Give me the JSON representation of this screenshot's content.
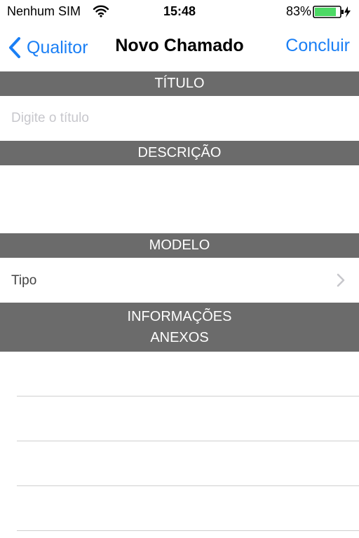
{
  "status": {
    "carrier": "Nenhum SIM",
    "time": "15:48",
    "battery_pct": "83%"
  },
  "nav": {
    "back_label": "Qualitor",
    "title": "Novo Chamado",
    "done_label": "Concluir"
  },
  "sections": {
    "titulo": "TÍTULO",
    "descricao": "DESCRIÇÃO",
    "modelo": "MODELO",
    "informacoes": "INFORMAÇÕES",
    "anexos": "ANEXOS"
  },
  "form": {
    "title_placeholder": "Digite o título",
    "title_value": "",
    "tipo_label": "Tipo"
  },
  "colors": {
    "accent": "#1a7ff5",
    "header_bg": "#6b6b6b",
    "battery": "#4cd964"
  },
  "icons": {
    "wifi": "wifi-icon",
    "battery": "battery-icon",
    "back": "chevron-left-icon",
    "disclosure": "chevron-right-icon"
  }
}
